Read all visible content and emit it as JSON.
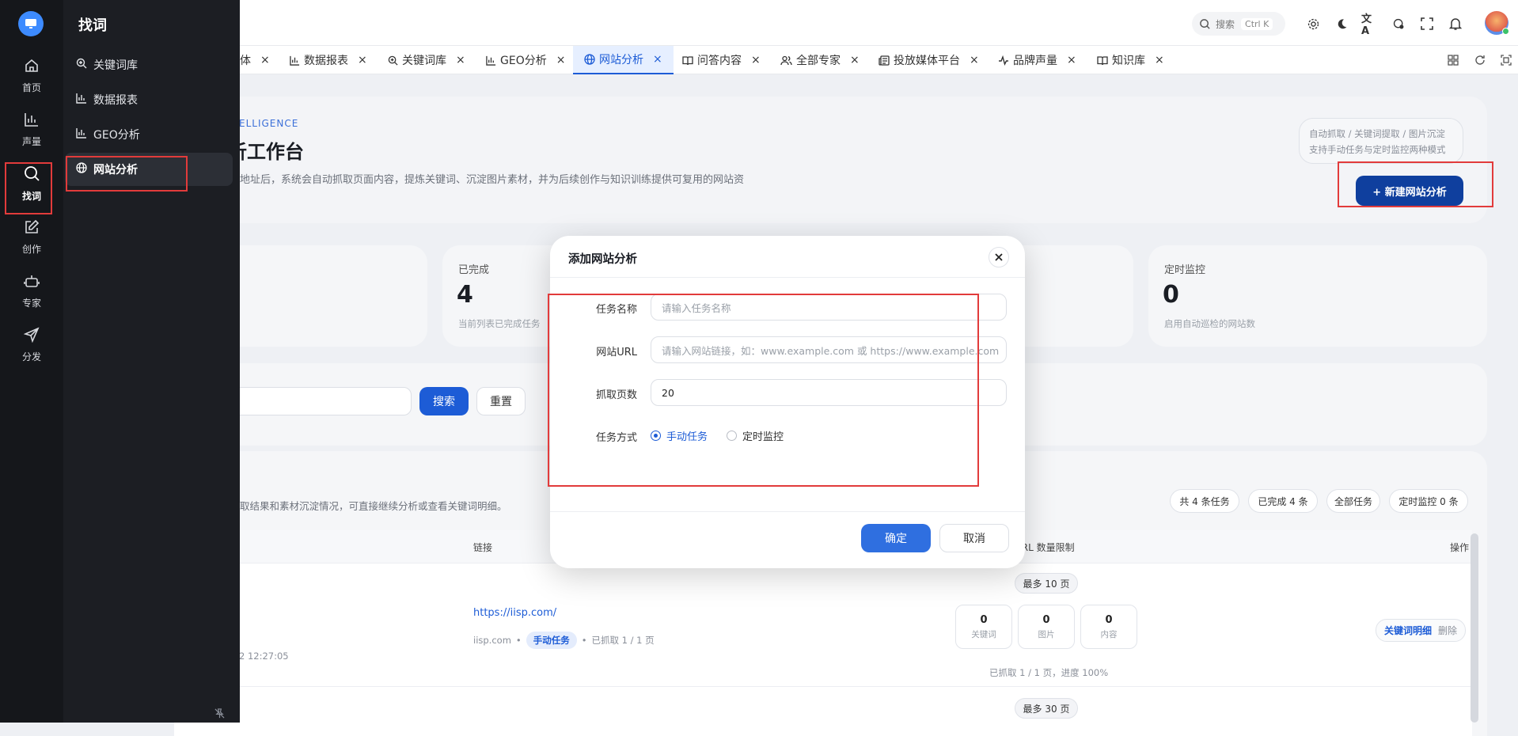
{
  "header": {
    "search_label": "搜索",
    "search_shortcut": "Ctrl K"
  },
  "tabs": [
    {
      "label": "体",
      "icon": "partial-tab"
    },
    {
      "label": "数据报表",
      "icon": "bar-chart-icon"
    },
    {
      "label": "关键词库",
      "icon": "search-zoom-icon"
    },
    {
      "label": "GEO分析",
      "icon": "bar-chart-icon"
    },
    {
      "label": "网站分析",
      "icon": "globe-icon",
      "active": true
    },
    {
      "label": "问答内容",
      "icon": "book-icon"
    },
    {
      "label": "全部专家",
      "icon": "users-icon"
    },
    {
      "label": "投放媒体平台",
      "icon": "newspaper-icon"
    },
    {
      "label": "品牌声量",
      "icon": "activity-icon"
    },
    {
      "label": "知识库",
      "icon": "book-icon"
    }
  ],
  "rail": {
    "items": [
      {
        "label": "首页",
        "icon": "home-icon"
      },
      {
        "label": "声量",
        "icon": "bar-chart-icon"
      },
      {
        "label": "找词",
        "icon": "search-icon",
        "active": true
      },
      {
        "label": "创作",
        "icon": "edit-icon"
      },
      {
        "label": "专家",
        "icon": "bot-icon"
      },
      {
        "label": "分发",
        "icon": "send-icon"
      }
    ]
  },
  "flyout": {
    "title": "找词",
    "items": [
      {
        "label": "关键词库",
        "icon": "search-zoom-icon"
      },
      {
        "label": "数据报表",
        "icon": "bar-chart-icon"
      },
      {
        "label": "GEO分析",
        "icon": "bar-chart-icon"
      },
      {
        "label": "网站分析",
        "icon": "globe-icon",
        "active": true
      }
    ]
  },
  "hero": {
    "eyebrow": "ELLIGENCE",
    "title": "析工作台",
    "description": "地址后，系统会自动抓取页面内容，提炼关键词、沉淀图片素材，并为后续创作与知识训练提供可复用的网站资",
    "note_line1": "自动抓取 / 关键词提取 / 图片沉淀",
    "note_line2": "支持手动任务与定时监控两种模式",
    "new_button": "+ 新建网站分析"
  },
  "stats": [
    {
      "label": "已完成",
      "value": "4",
      "sub": "当前列表已完成任务"
    },
    {
      "label": "定时监控",
      "value": "0",
      "sub": "启用自动巡检的网站数"
    }
  ],
  "filter": {
    "search_button": "搜索",
    "reset_button": "重置"
  },
  "list": {
    "desc": "取结果和素材沉淀情况，可直接继续分析或查看关键词明细。",
    "pills": [
      "共 4 条任务",
      "已完成 4 条",
      "全部任务",
      "定时监控 0 条"
    ],
    "col_link": "链接",
    "col_limit": "URL 数量限制",
    "col_ops": "操作",
    "row": {
      "url": "https://iisp.com/",
      "domain": "iisp.com",
      "mode_tag": "手动任务",
      "crawled": "已抓取 1 / 1 页",
      "date": "2 12:27:05",
      "limit": "最多 10 页",
      "keywords_n": "0",
      "keywords_l": "关键词",
      "images_n": "0",
      "images_l": "图片",
      "content_n": "0",
      "content_l": "内容",
      "progress": "已抓取 1 / 1 页，进度 100%",
      "op_detail": "关键词明细",
      "op_delete": "删除"
    },
    "next_limit": "最多 30 页"
  },
  "dialog": {
    "title": "添加网站分析",
    "task_name_label": "任务名称",
    "task_name_placeholder": "请输入任务名称",
    "url_label": "网站URL",
    "url_placeholder": "请输入网站链接，如：www.example.com 或 https://www.example.com",
    "pages_label": "抓取页数",
    "pages_value": "20",
    "mode_label": "任务方式",
    "mode_manual": "手动任务",
    "mode_scheduled": "定时监控",
    "confirm": "确定",
    "cancel": "取消"
  },
  "colors": {
    "accent": "#1d5cd6",
    "primary_btn": "#0f3f9e",
    "annotation": "#e23b3b",
    "sidebar_dark": "#15171b"
  }
}
